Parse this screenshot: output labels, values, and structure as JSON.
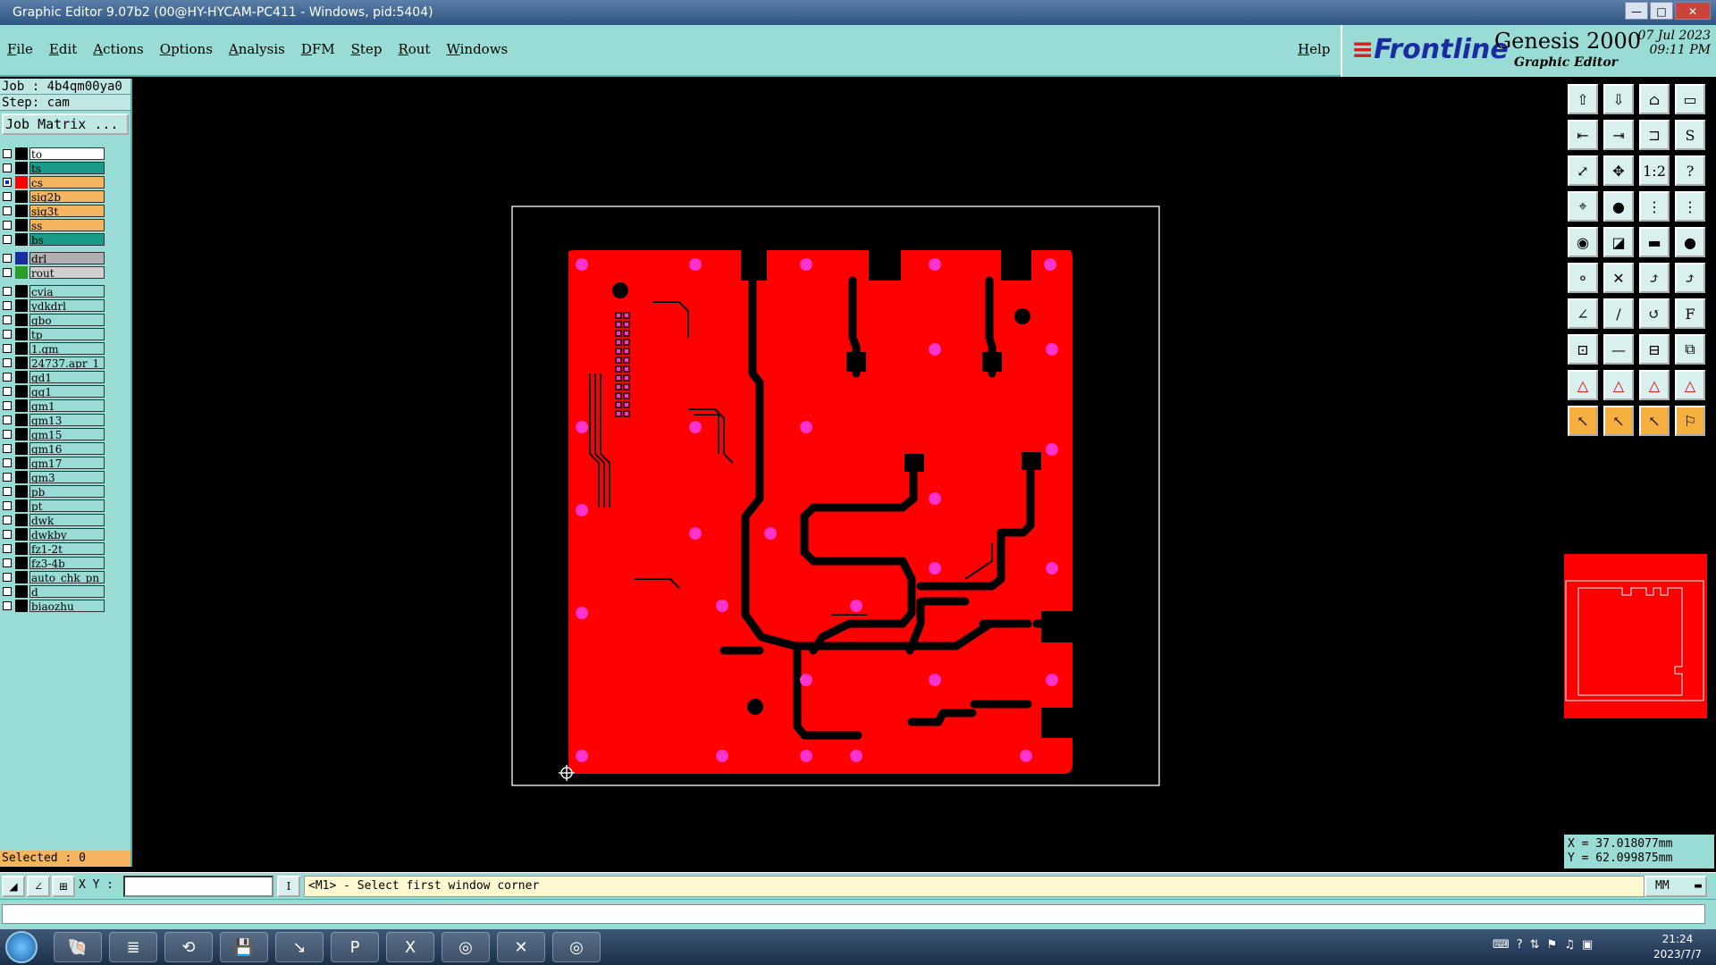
{
  "window": {
    "title": "Graphic Editor 9.07b2 (00@HY-HYCAM-PC411 - Windows, pid:5404)"
  },
  "menu": {
    "items": [
      "File",
      "Edit",
      "Actions",
      "Options",
      "Analysis",
      "DFM",
      "Step",
      "Rout",
      "Windows"
    ],
    "help": "Help"
  },
  "brand": {
    "logo": "Frontline",
    "product": "Genesis 2000",
    "subtitle": "Graphic Editor",
    "date": "07 Jul 2023",
    "time": "09:11 PM"
  },
  "job": {
    "job_line": "Job : 4b4qm00ya0",
    "step_line": "Step: cam",
    "matrix_button": "Job Matrix ..."
  },
  "layers": [
    {
      "name": "to",
      "swatch": "#000000",
      "bg": "#ffffff",
      "checked": false
    },
    {
      "name": "ts",
      "swatch": "#000000",
      "bg": "#1a9c88",
      "checked": false
    },
    {
      "name": "cs",
      "swatch": "#ff0000",
      "bg": "#f5b560",
      "checked": true
    },
    {
      "name": "sig2b",
      "swatch": "#000000",
      "bg": "#f5b560",
      "checked": false
    },
    {
      "name": "sig3t",
      "swatch": "#000000",
      "bg": "#f5b560",
      "checked": false
    },
    {
      "name": "ss",
      "swatch": "#000000",
      "bg": "#f5b560",
      "checked": false
    },
    {
      "name": "bs",
      "swatch": "#000000",
      "bg": "#1a9c88",
      "checked": false
    },
    {
      "name": "drl",
      "swatch": "#1b2ca0",
      "bg": "#b0b0b0",
      "checked": false,
      "gap": true
    },
    {
      "name": "rout",
      "swatch": "#2a9c2a",
      "bg": "#d0d0d0",
      "checked": false
    },
    {
      "name": "cvia",
      "swatch": "#000000",
      "bg": "#99dcd6",
      "checked": false,
      "gap": true
    },
    {
      "name": "ydkdrl",
      "swatch": "#000000",
      "bg": "#99dcd6",
      "checked": false
    },
    {
      "name": "gbo",
      "swatch": "#000000",
      "bg": "#99dcd6",
      "checked": false
    },
    {
      "name": "tp",
      "swatch": "#000000",
      "bg": "#99dcd6",
      "checked": false
    },
    {
      "name": "1.gm",
      "swatch": "#000000",
      "bg": "#99dcd6",
      "checked": false
    },
    {
      "name": "24737.apr_1",
      "swatch": "#000000",
      "bg": "#99dcd6",
      "checked": false
    },
    {
      "name": "gd1",
      "swatch": "#000000",
      "bg": "#99dcd6",
      "checked": false
    },
    {
      "name": "gg1",
      "swatch": "#000000",
      "bg": "#99dcd6",
      "checked": false
    },
    {
      "name": "gm1",
      "swatch": "#000000",
      "bg": "#99dcd6",
      "checked": false
    },
    {
      "name": "gm13",
      "swatch": "#000000",
      "bg": "#99dcd6",
      "checked": false
    },
    {
      "name": "gm15",
      "swatch": "#000000",
      "bg": "#99dcd6",
      "checked": false
    },
    {
      "name": "gm16",
      "swatch": "#000000",
      "bg": "#99dcd6",
      "checked": false
    },
    {
      "name": "gm17",
      "swatch": "#000000",
      "bg": "#99dcd6",
      "checked": false
    },
    {
      "name": "gm3",
      "swatch": "#000000",
      "bg": "#99dcd6",
      "checked": false
    },
    {
      "name": "pb",
      "swatch": "#000000",
      "bg": "#99dcd6",
      "checked": false
    },
    {
      "name": "pt",
      "swatch": "#000000",
      "bg": "#99dcd6",
      "checked": false
    },
    {
      "name": "dwk",
      "swatch": "#000000",
      "bg": "#99dcd6",
      "checked": false
    },
    {
      "name": "dwkby",
      "swatch": "#000000",
      "bg": "#99dcd6",
      "checked": false
    },
    {
      "name": "fz1-2t",
      "swatch": "#000000",
      "bg": "#99dcd6",
      "checked": false
    },
    {
      "name": "fz3-4b",
      "swatch": "#000000",
      "bg": "#99dcd6",
      "checked": false
    },
    {
      "name": "auto_chk_pn",
      "swatch": "#000000",
      "bg": "#99dcd6",
      "checked": false
    },
    {
      "name": "d",
      "swatch": "#000000",
      "bg": "#99dcd6",
      "checked": false
    },
    {
      "name": "biaozhu",
      "swatch": "#000000",
      "bg": "#99dcd6",
      "checked": false
    }
  ],
  "selected": "Selected : 0",
  "toolbar_icons": [
    "open-icon",
    "save-icon",
    "home-icon",
    "window-icon",
    "import-icon",
    "export-icon",
    "frame-icon",
    "snap-icon",
    "zoom-fit-icon",
    "zoom-in-icon",
    "scale-1-2-icon",
    "help-icon",
    "measure-icon",
    "pad-icon",
    "route-icon",
    "drc-icon",
    "circle-pad-icon",
    "contour-icon",
    "line-icon",
    "dot-icon",
    "node-icon",
    "cross-icon",
    "connect-icon",
    "link-icon",
    "angle-icon",
    "draw-icon",
    "arc-icon",
    "text-icon",
    "move-icon",
    "edge-icon",
    "shift-icon",
    "copy-icon",
    "tri-a-icon",
    "tri-b-icon",
    "tri-c-icon",
    "tri-d-icon",
    "pointer-icon",
    "select-icon",
    "pick-icon",
    "rout-icon"
  ],
  "coords": {
    "x": "X = 37.018077mm",
    "y": "Y = 62.099875mm"
  },
  "command": {
    "xy_label": "X Y :",
    "xy_value": "",
    "prompt": "<M1> - Select first window corner",
    "units": "MM"
  },
  "taskbar": {
    "apps": [
      "shell-icon",
      "notepad-icon",
      "browser-icon",
      "save-icon",
      "pointer-icon",
      "p-icon",
      "excel-icon",
      "eye-icon",
      "x-icon",
      "eye2-icon"
    ],
    "time": "21:24",
    "date": "2023/7/7"
  },
  "colors": {
    "copper": "#ff0000",
    "pad": "#ff33cc",
    "panel": "#99dcd6",
    "highlight": "#f5b560"
  }
}
